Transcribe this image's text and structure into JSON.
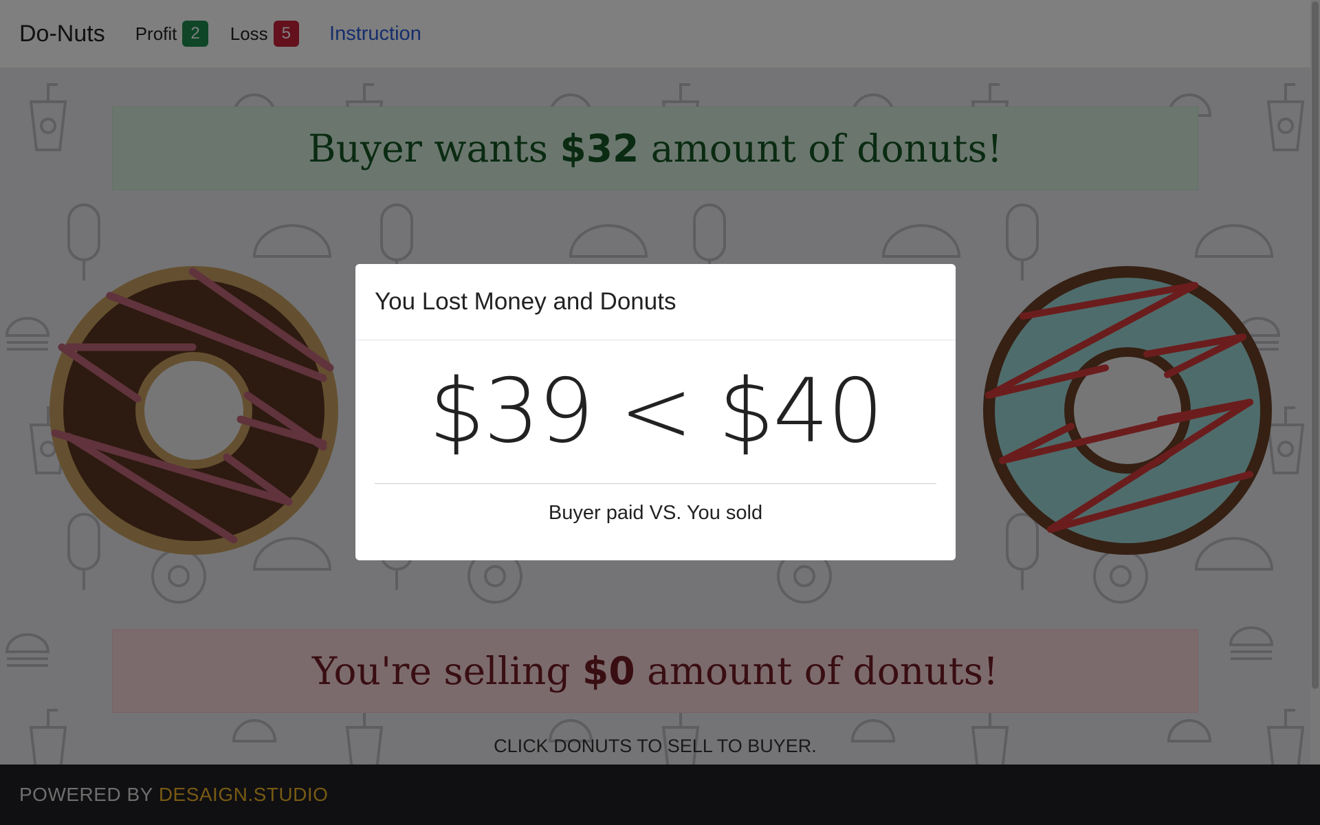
{
  "navbar": {
    "brand": "Do-Nuts",
    "profit_label": "Profit",
    "profit_count": "2",
    "loss_label": "Loss",
    "loss_count": "5",
    "instruction_link": "Instruction"
  },
  "game": {
    "buyer_prefix": "Buyer wants ",
    "buyer_amount": "$32",
    "buyer_suffix": " amount of donuts!",
    "sell_prefix": "You're selling ",
    "sell_amount": "$0",
    "sell_suffix": " amount of donuts!",
    "instructions": "CLICK DONUTS TO SELL TO BUYER."
  },
  "modal": {
    "title": "You Lost Money and Donuts",
    "comparison": "$39 < $40",
    "caption": "Buyer paid VS. You sold"
  },
  "footer": {
    "powered_by": "POWERED BY",
    "studio": "DESAIGN.STUDIO"
  },
  "colors": {
    "profit_badge": "#1e8c4e",
    "loss_badge": "#c8233a",
    "link": "#2b5bd6",
    "footer_bg": "#202124",
    "footer_accent": "#f0b429"
  }
}
